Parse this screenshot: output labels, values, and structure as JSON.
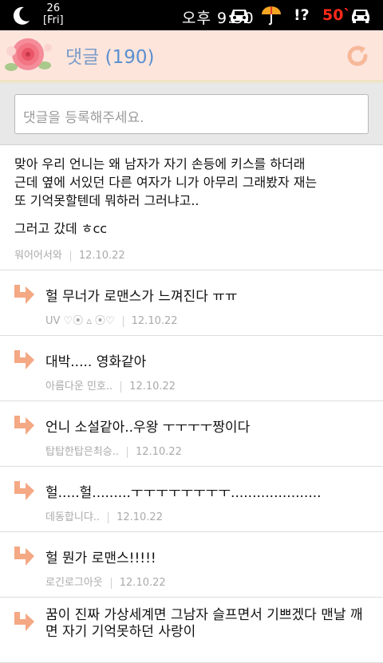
{
  "status_bar": {
    "date_day": "26",
    "date_weekday": "[Fri]",
    "time": "오후 9:30",
    "alert": "!?",
    "temperature": "50`",
    "icons": [
      "moon-icon",
      "car-icon",
      "umbrella-icon",
      "car-icon"
    ]
  },
  "header": {
    "title": "댓글",
    "count": "(190)",
    "refresh_icon": "refresh-icon"
  },
  "input": {
    "placeholder": "댓글을 등록해주세요."
  },
  "main_comment": {
    "text_lines": [
      "맞아 우리 언니는 왜 남자가 자기 손등에 키스를 하더래",
      "근데 옆에 서있던 다른 여자가 니가 아무리 그래봤자 재는",
      "또 기억못할텐데 뭐하러 그러냐고.."
    ],
    "text2": "그러고 갔데 ㅎcc",
    "author": "워어어서와",
    "date": "12.10.22"
  },
  "replies": [
    {
      "text": "헐 무너가 로맨스가 느껴진다 ㅠㅠ",
      "author": "UV ♡⦿ ▵ ⦿♡",
      "date": "12.10.22"
    },
    {
      "text": "대박..... 영화같아",
      "author": "아름다운 민호..",
      "date": "12.10.22"
    },
    {
      "text": "언니 소설같아..우왕 ㅜㅜㅜㅜ짱이다",
      "author": "탑탑한탑은최승..",
      "date": "12.10.22"
    },
    {
      "text": "헐.....헐.........ㅜㅜㅜㅜㅜㅜㅜㅜ.....................",
      "author": "데동합니댜..",
      "date": "12.10.22"
    },
    {
      "text": "헐 뭔가 로맨스!!!!!",
      "author": "로긴로그아웃",
      "date": "12.10.22"
    },
    {
      "text": "꿈이 진짜 가상세계면 그남자 슬프면서 기쁘겠다 맨날 깨면 자기 기억못하던 사랑이",
      "author": "",
      "date": ""
    }
  ],
  "colors": {
    "header_bg": "#fde5dc",
    "title": "#7a9cc8",
    "reply_arrow": "#f4a883",
    "refresh": "#f7b89a"
  }
}
